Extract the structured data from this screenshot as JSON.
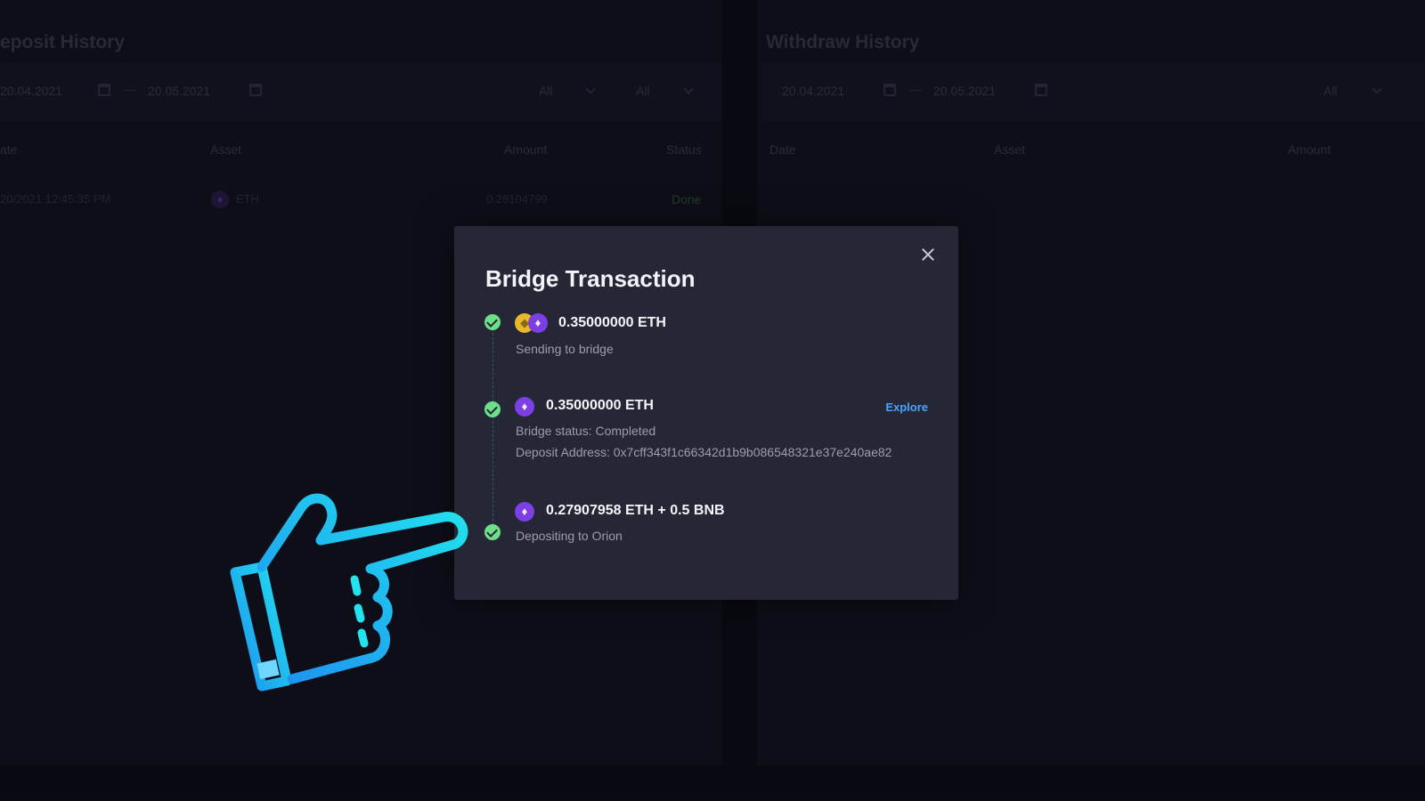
{
  "deposit_history": {
    "title": "eposit History",
    "date_from": "20.04.2021",
    "date_to": "20.05.2021",
    "filter_1": "All",
    "filter_2": "All",
    "columns": [
      "ate",
      "Asset",
      "Amount",
      "Status"
    ],
    "row": {
      "date": "20/2021 12:45:35 PM",
      "asset": "ETH",
      "amount": "0.28104799",
      "status": "Done"
    }
  },
  "withdraw_history": {
    "title": "Withdraw History",
    "date_from": "20.04.2021",
    "date_to": "20.05.2021",
    "filter_1": "All",
    "columns": [
      "Date",
      "Asset",
      "Amount"
    ]
  },
  "modal": {
    "title": "Bridge Transaction",
    "steps": [
      {
        "amount": "0.35000000 ETH",
        "sub": "Sending to bridge"
      },
      {
        "amount": "0.35000000 ETH",
        "sub": "Bridge status: Completed",
        "sub2": "Deposit Address: 0x7cff343f1c66342d1b9b086548321e37e240ae82",
        "link": "Explore"
      },
      {
        "amount": "0.27907958 ETH + 0.5 BNB",
        "sub": "Depositing to Orion"
      }
    ]
  },
  "colors": {
    "accent_link": "#4aa3ff",
    "check": "#6dde8a",
    "eth": "#7b3fe4",
    "bnb": "#e9b92d",
    "hand": "#1fc8f0"
  },
  "icons": [
    "calendar-icon",
    "chevron-down-icon",
    "close-icon",
    "check-circle-icon",
    "eth-coin-icon",
    "bnb-coin-icon",
    "pointing-hand-icon"
  ]
}
